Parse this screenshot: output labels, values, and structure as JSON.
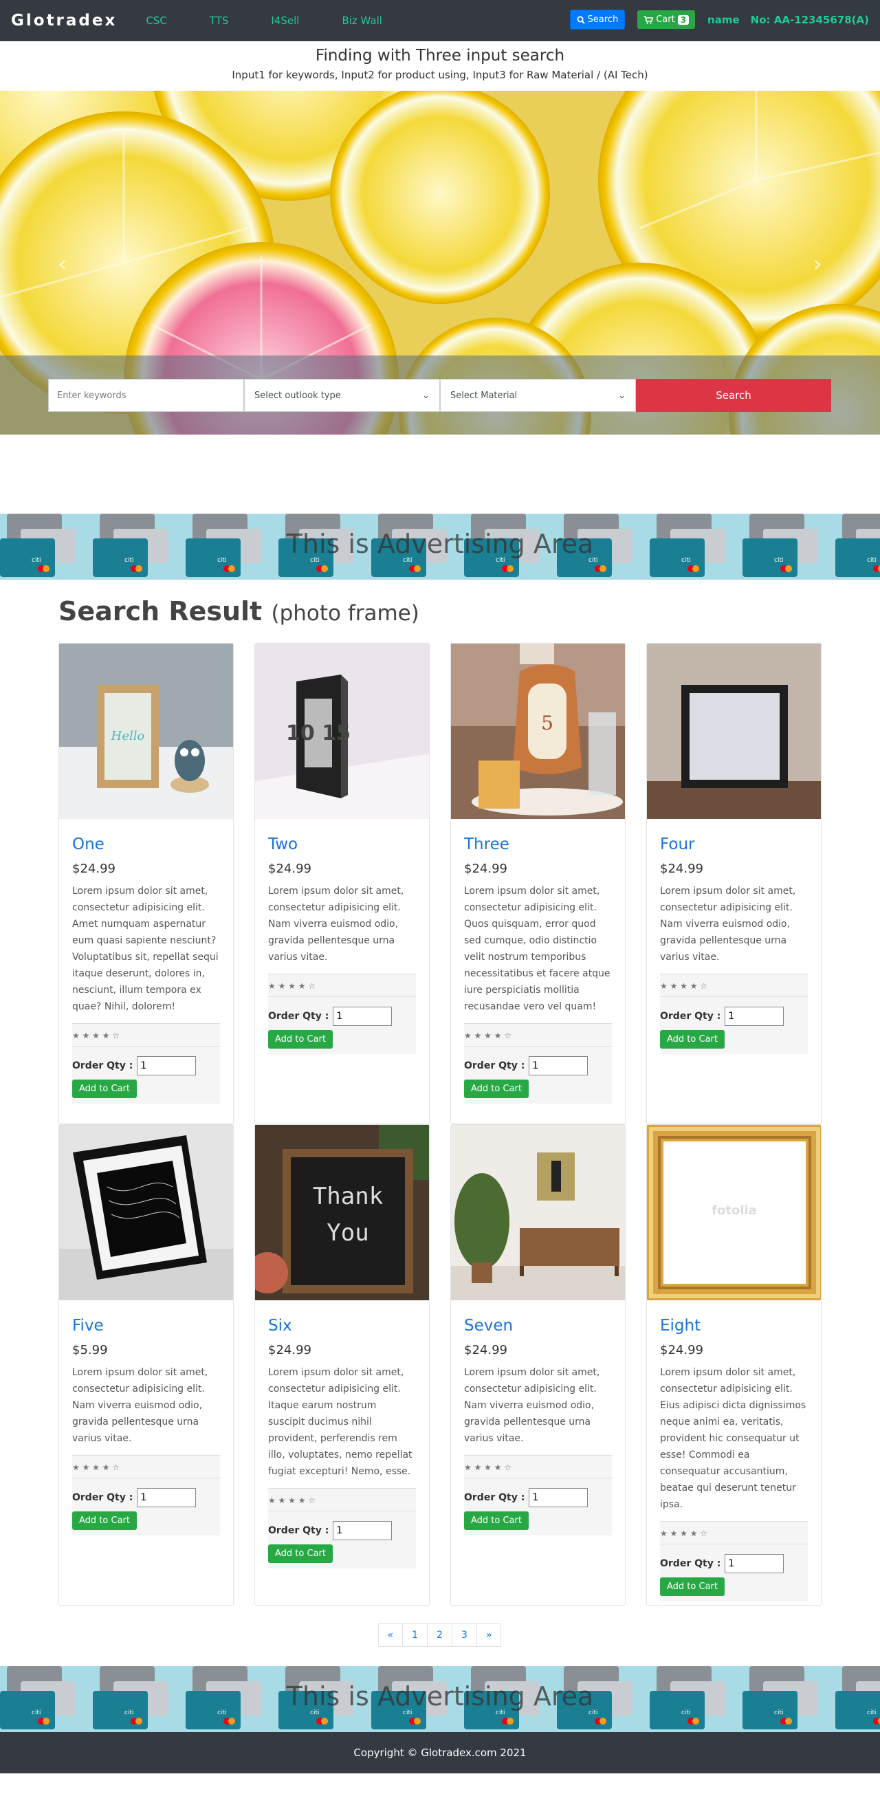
{
  "nav": {
    "brand": "Glotradex",
    "links": [
      "CSC",
      "TTS",
      "I4Sell",
      "Biz Wall"
    ],
    "search_label": "Search",
    "cart_label": "Cart",
    "cart_count": "3",
    "user_name": "name",
    "account_no": "No: AA-12345678(A)"
  },
  "header": {
    "title": "Finding with Three input search",
    "subtitle": "Input1 for keywords, Input2 for product using, Input3 for Raw Material / (AI Tech)"
  },
  "search": {
    "keywords_placeholder": "Enter keywords",
    "outlook_selected": "Select outlook type",
    "material_selected": "Select Material",
    "button": "Search"
  },
  "ad": {
    "text": "This is Advertising Area"
  },
  "results": {
    "heading": "Search Result",
    "category": "(photo frame)",
    "order_qty_label": "Order Qty :",
    "add_to_cart_label": "Add to Cart",
    "products": [
      {
        "name": "One",
        "price": "$24.99",
        "desc": "Lorem ipsum dolor sit amet, consectetur adipisicing elit. Amet numquam aspernatur eum quasi sapiente nesciunt? Voluptatibus sit, repellat sequi itaque deserunt, dolores in, nesciunt, illum tempora ex quae? Nihil, dolorem!",
        "rating": "★ ★ ★ ★ ☆",
        "qty": "1"
      },
      {
        "name": "Two",
        "price": "$24.99",
        "desc": "Lorem ipsum dolor sit amet, consectetur adipisicing elit. Nam viverra euismod odio, gravida pellentesque urna varius vitae.",
        "rating": "★ ★ ★ ★ ☆",
        "qty": "1"
      },
      {
        "name": "Three",
        "price": "$24.99",
        "desc": "Lorem ipsum dolor sit amet, consectetur adipisicing elit. Quos quisquam, error quod sed cumque, odio distinctio velit nostrum temporibus necessitatibus et facere atque iure perspiciatis mollitia recusandae vero vel quam!",
        "rating": "★ ★ ★ ★ ☆",
        "qty": "1"
      },
      {
        "name": "Four",
        "price": "$24.99",
        "desc": "Lorem ipsum dolor sit amet, consectetur adipisicing elit. Nam viverra euismod odio, gravida pellentesque urna varius vitae.",
        "rating": "★ ★ ★ ★ ☆",
        "qty": "1"
      },
      {
        "name": "Five",
        "price": "$5.99",
        "desc": "Lorem ipsum dolor sit amet, consectetur adipisicing elit. Nam viverra euismod odio, gravida pellentesque urna varius vitae.",
        "rating": "★ ★ ★ ★ ☆",
        "qty": "1"
      },
      {
        "name": "Six",
        "price": "$24.99",
        "desc": "Lorem ipsum dolor sit amet, consectetur adipisicing elit. Itaque earum nostrum suscipit ducimus nihil provident, perferendis rem illo, voluptates, nemo repellat fugiat excepturi! Nemo, esse.",
        "rating": "★ ★ ★ ★ ☆",
        "qty": "1"
      },
      {
        "name": "Seven",
        "price": "$24.99",
        "desc": "Lorem ipsum dolor sit amet, consectetur adipisicing elit. Nam viverra euismod odio, gravida pellentesque urna varius vitae.",
        "rating": "★ ★ ★ ★ ☆",
        "qty": "1"
      },
      {
        "name": "Eight",
        "price": "$24.99",
        "desc": "Lorem ipsum dolor sit amet, consectetur adipisicing elit. Eius adipisci dicta dignissimos neque animi ea, veritatis, provident hic consequatur ut esse! Commodi ea consequatur accusantium, beatae qui deserunt tenetur ipsa.",
        "rating": "★ ★ ★ ★ ☆",
        "qty": "1"
      }
    ],
    "thumb_text": {
      "two": "10 15",
      "three": "5",
      "six_line1": "Thank",
      "six_line2": "You",
      "eight": "fotolia",
      "one": "Hello"
    }
  },
  "pagination": [
    "«",
    "1",
    "2",
    "3",
    "»"
  ],
  "footer": {
    "copyright": "Copyright © Glotradex.com 2021"
  }
}
